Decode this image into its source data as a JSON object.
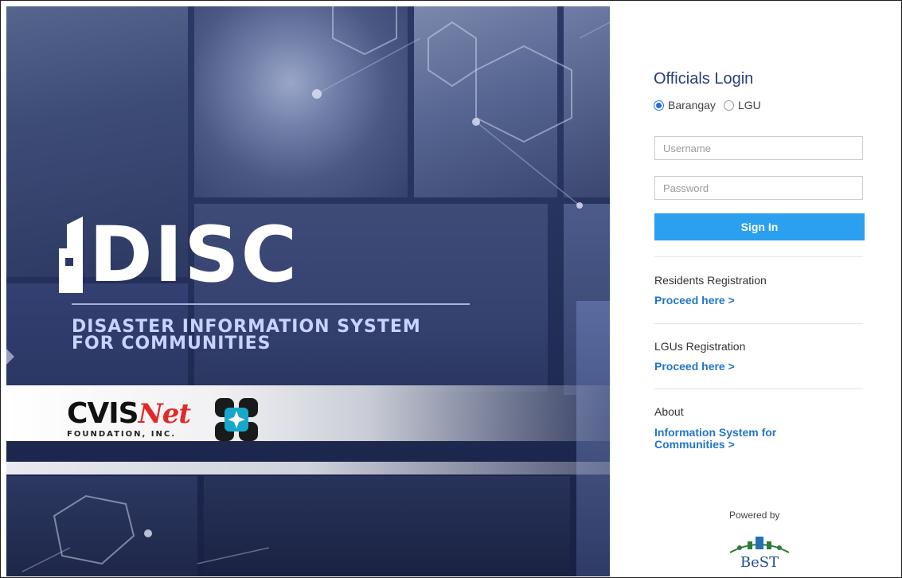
{
  "hero": {
    "logo_text": "DISC",
    "tagline_line1": "DISASTER INFORMATION SYSTEM",
    "tagline_line2": "FOR COMMUNITIES",
    "partner_main": "CVIS",
    "partner_net": "Net",
    "partner_sub": "FOUNDATION, INC."
  },
  "login": {
    "title": "Officials Login",
    "radio_options": [
      {
        "label": "Barangay",
        "selected": true
      },
      {
        "label": "LGU",
        "selected": false
      }
    ],
    "username_placeholder": "Username",
    "username_value": "",
    "password_placeholder": "Password",
    "password_value": "",
    "signin_label": "Sign In"
  },
  "sections": [
    {
      "label": "Residents Registration",
      "link": "Proceed here >"
    },
    {
      "label": "LGUs Registration",
      "link": "Proceed here >"
    },
    {
      "label": "About",
      "link": "Information System for Communities >"
    }
  ],
  "footer": {
    "powered_by": "Powered by",
    "brand": "BeST"
  },
  "colors": {
    "title": "#2a3e7a",
    "button": "#2aa0ee",
    "link": "#2276c4",
    "hero_bg": "#26345f"
  }
}
